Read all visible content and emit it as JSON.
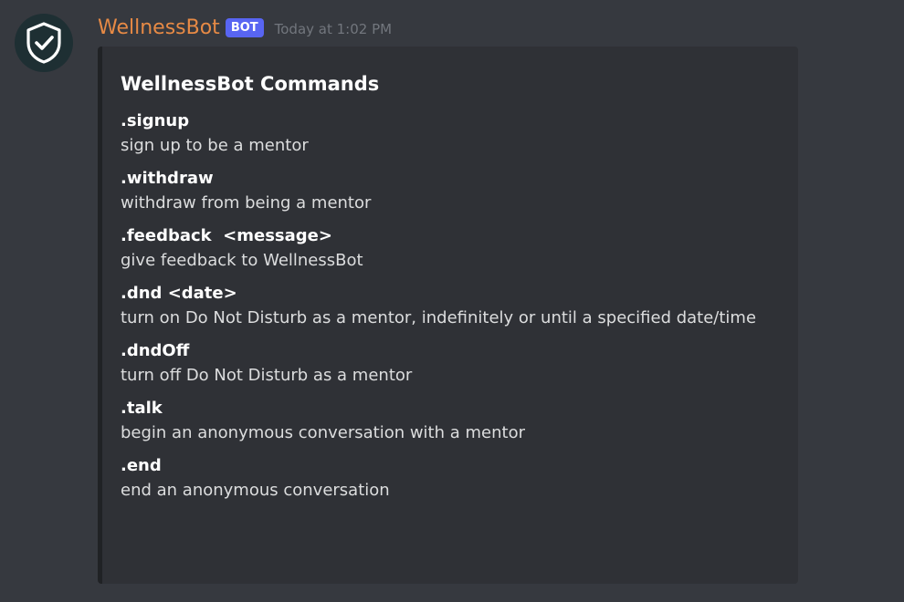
{
  "message": {
    "avatar_icon": "shield-check-icon",
    "author": "WellnessBot",
    "bot_tag": "BOT",
    "timestamp": "Today at 1:02 PM",
    "colors": {
      "background": "#36393f",
      "embed_background": "#2f3136",
      "username": "#e78a45",
      "bot_tag": "#5865f2",
      "avatar_background": "#1e2f33"
    }
  },
  "embed": {
    "title": "WellnessBot Commands",
    "fields": [
      {
        "name": ".signup",
        "value": "sign up to be a mentor"
      },
      {
        "name": ".withdraw",
        "value": "withdraw from being a mentor"
      },
      {
        "name": ".feedback  <message>",
        "value": "give feedback to WellnessBot"
      },
      {
        "name": ".dnd <date>",
        "value": "turn on Do Not Disturb as a mentor, indefinitely or until a specified date/time"
      },
      {
        "name": ".dndOff",
        "value": "turn off Do Not Disturb as a mentor"
      },
      {
        "name": ".talk",
        "value": "begin an anonymous conversation with a mentor"
      },
      {
        "name": ".end",
        "value": "end an anonymous conversation"
      }
    ]
  }
}
